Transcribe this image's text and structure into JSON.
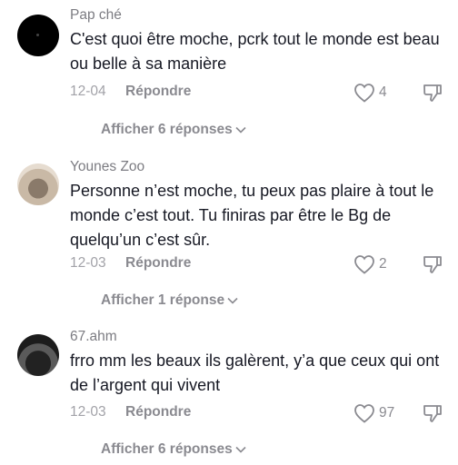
{
  "comments": [
    {
      "username": "Pap ché",
      "text": "C'est quoi être moche, pcrk tout le monde est beau ou belle à sa manière",
      "date": "12-04",
      "reply_label": "Répondre",
      "likes": "4",
      "view_replies": "Afficher 6 réponses",
      "avatar": "black-avatar"
    },
    {
      "username": "Younes Zoo",
      "text": "Personne n’est moche, tu peux pas plaire à tout le monde c’est tout. Tu finiras par être le Bg de quelqu’un c’est sûr.",
      "date": "12-03",
      "reply_label": "Répondre",
      "likes": "2",
      "view_replies": "Afficher 1 réponse",
      "avatar": "photo-avatar"
    },
    {
      "username": "67.ahm",
      "text": "frro mm les beaux ils galèrent, y’a que ceux qui ont de l’argent qui vivent",
      "date": "12-03",
      "reply_label": "Répondre",
      "likes": "97",
      "view_replies": "Afficher 6 réponses",
      "avatar": "car-avatar"
    }
  ],
  "icons": {
    "like": "heart-outline-icon",
    "dislike": "thumbs-down-icon",
    "chevron": "chevron-down-icon"
  }
}
